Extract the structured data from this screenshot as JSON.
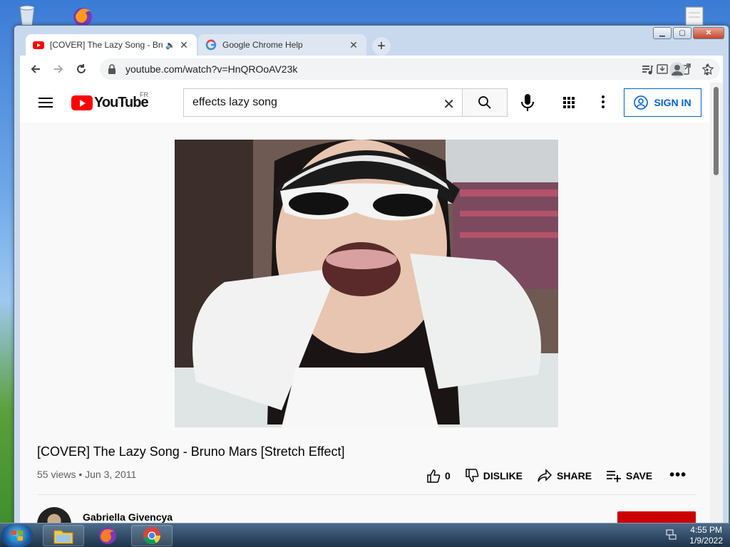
{
  "browser": {
    "tabs": [
      {
        "label": "[COVER] The Lazy Song - Bru",
        "active": true,
        "audio": true
      },
      {
        "label": "Google Chrome Help",
        "active": false
      }
    ],
    "url": "youtube.com/watch?v=HnQROoAV23k"
  },
  "youtube": {
    "country_code": "FR",
    "search_value": "effects lazy song",
    "sign_in_label": "SIGN IN",
    "video": {
      "title": "[COVER] The Lazy Song - Bruno Mars [Stretch Effect]",
      "meta": "55 views • Jun 3, 2011",
      "like_count": "0",
      "dislike_label": "DISLIKE",
      "share_label": "SHARE",
      "save_label": "SAVE"
    },
    "channel": {
      "name": "Gabriella Givencya"
    }
  },
  "taskbar": {
    "time": "4:55 PM",
    "date": "1/9/2022"
  },
  "colors": {
    "youtube_red": "#ff0000",
    "link_blue": "#065fd4",
    "subscribe_red": "#cc0000"
  }
}
